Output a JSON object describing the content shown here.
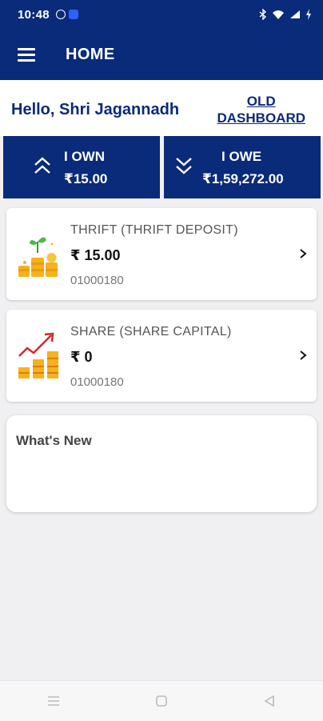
{
  "status_bar": {
    "time": "10:48"
  },
  "app_bar": {
    "title": "HOME"
  },
  "greeting": {
    "text": "Hello, Shri Jagannadh",
    "old_dashboard_line1": "OLD",
    "old_dashboard_line2": "DASHBOARD"
  },
  "summary": {
    "own": {
      "label": "I OWN",
      "amount": "₹15.00"
    },
    "owe": {
      "label": "I OWE",
      "amount": "₹1,59,272.00"
    }
  },
  "accounts": [
    {
      "title": "THRIFT  (THRIFT DEPOSIT)",
      "amount": "₹ 15.00",
      "account_no": "01000180",
      "icon": "coins-plant-icon"
    },
    {
      "title": "SHARE  (SHARE CAPITAL)",
      "amount": "₹ 0",
      "account_no": "01000180",
      "icon": "growth-bars-icon"
    }
  ],
  "whats_new": {
    "heading": "What's New"
  },
  "colors": {
    "primary": "#0a2a7a",
    "background": "#f0f0f2",
    "gold": "#f5b21a"
  }
}
